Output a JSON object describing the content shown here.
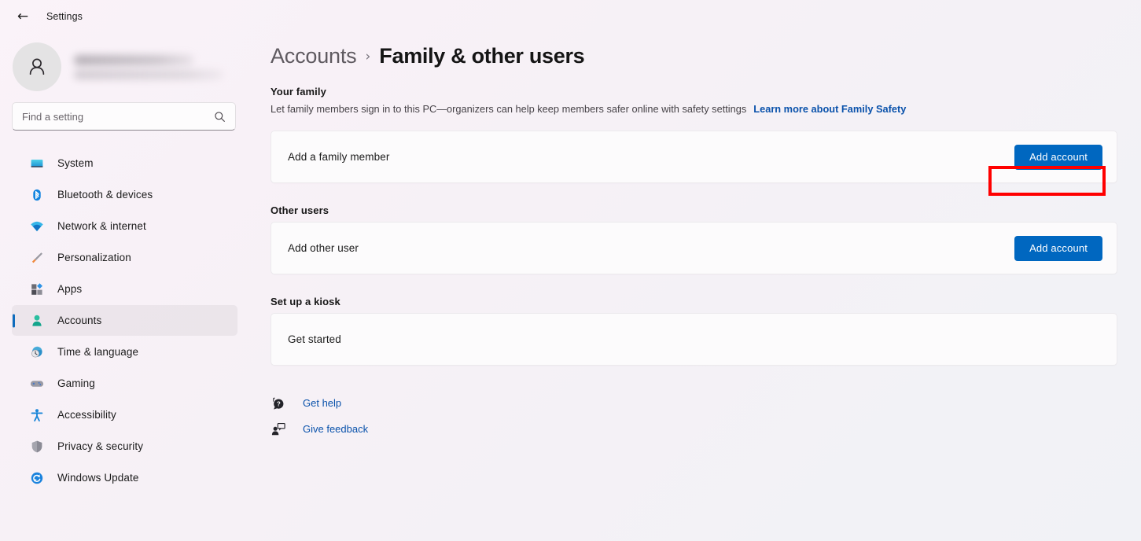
{
  "window": {
    "app_title": "Settings",
    "back_icon": "back-arrow-icon"
  },
  "sidebar": {
    "profile": {
      "avatar_icon": "person-avatar-icon",
      "name_redacted": "",
      "email_redacted": ""
    },
    "search": {
      "placeholder": "Find a setting",
      "value": "",
      "icon": "search-icon"
    },
    "items": [
      {
        "label": "System",
        "icon": "monitor-icon",
        "selected": false
      },
      {
        "label": "Bluetooth & devices",
        "icon": "bluetooth-icon",
        "selected": false
      },
      {
        "label": "Network & internet",
        "icon": "wifi-icon",
        "selected": false
      },
      {
        "label": "Personalization",
        "icon": "paintbrush-icon",
        "selected": false
      },
      {
        "label": "Apps",
        "icon": "apps-grid-icon",
        "selected": false
      },
      {
        "label": "Accounts",
        "icon": "person-accounts-icon",
        "selected": true
      },
      {
        "label": "Time & language",
        "icon": "globe-clock-icon",
        "selected": false
      },
      {
        "label": "Gaming",
        "icon": "game-controller-icon",
        "selected": false
      },
      {
        "label": "Accessibility",
        "icon": "accessibility-icon",
        "selected": false
      },
      {
        "label": "Privacy & security",
        "icon": "shield-icon",
        "selected": false
      },
      {
        "label": "Windows Update",
        "icon": "update-refresh-icon",
        "selected": false
      }
    ]
  },
  "breadcrumb": {
    "parent": "Accounts",
    "separator": "›",
    "current": "Family & other users"
  },
  "sections": {
    "family": {
      "heading": "Your family",
      "description": "Let family members sign in to this PC—organizers can help keep members safer online with safety settings",
      "link": "Learn more about Family Safety",
      "row": {
        "title": "Add a family member",
        "button": "Add account",
        "highlighted": true
      }
    },
    "other_users": {
      "heading": "Other users",
      "row": {
        "title": "Add other user",
        "button": "Add account",
        "highlighted": false
      }
    },
    "kiosk": {
      "heading": "Set up a kiosk",
      "row": {
        "title": "Get started"
      }
    }
  },
  "footer": {
    "links": [
      {
        "label": "Get help",
        "icon": "help-question-bubble-icon"
      },
      {
        "label": "Give feedback",
        "icon": "feedback-person-bubble-icon"
      }
    ]
  },
  "colors": {
    "accent_blue": "#0067c0",
    "link_blue": "#0a52ab",
    "selection_bar": "#0f6cbd",
    "highlight_red": "#ff0000",
    "card_bg": "#fcfbfc"
  }
}
